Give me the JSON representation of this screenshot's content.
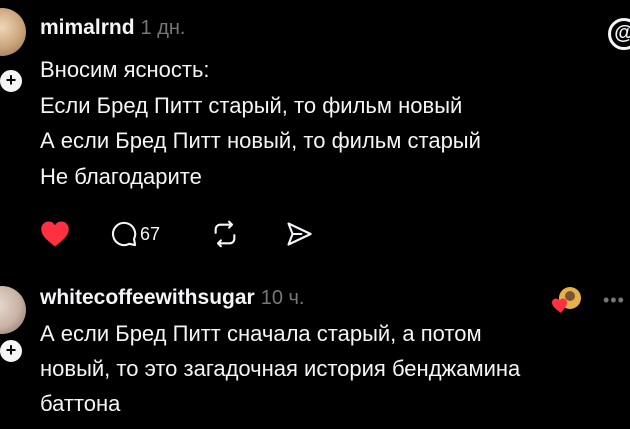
{
  "posts": [
    {
      "username": "mimalrnd",
      "time": "1 дн.",
      "lines": [
        "Вносим ясность:",
        "Если Бред Питт старый, то фильм новый",
        "А если Бред Питт новый, то фильм старый",
        "Не благодарите"
      ],
      "reply_count": "67",
      "liked": true,
      "like_color": "#ff3040"
    },
    {
      "username": "whitecoffeewithsugar",
      "time": "10 ч.",
      "lines": [
        "А если Бред Питт сначала старый, а потом",
        "новый, то это загадочная история бенджамина",
        "баттона"
      ]
    }
  ],
  "follow_symbol": "+",
  "threads_logo": "@",
  "more_symbol": "•••",
  "icons": [
    "heart-icon",
    "comment-icon",
    "repost-icon",
    "share-icon",
    "threads-logo-icon",
    "more-icon"
  ]
}
